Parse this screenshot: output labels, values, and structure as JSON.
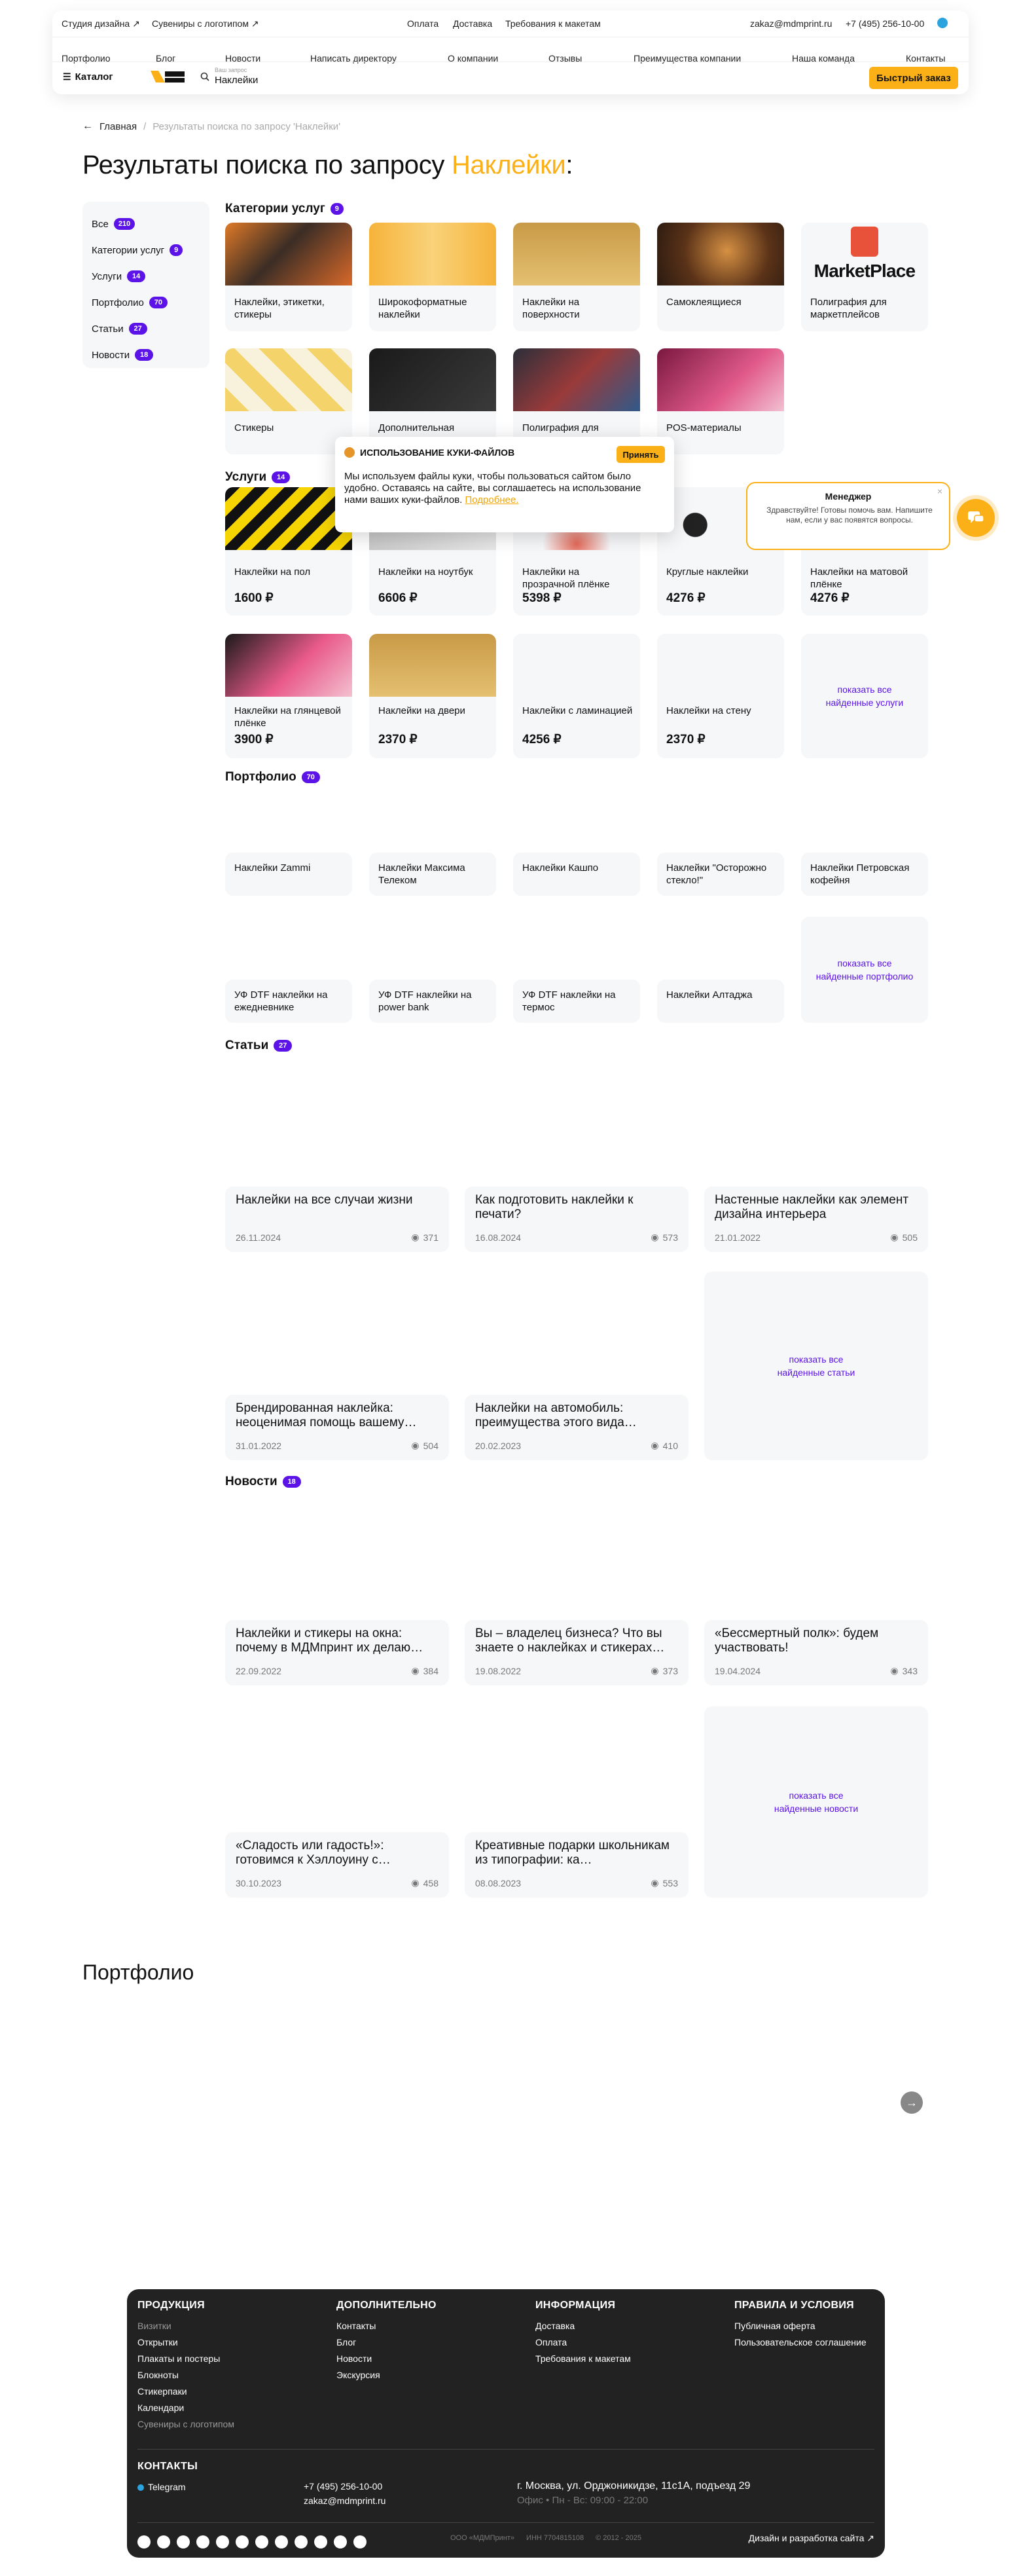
{
  "header": {
    "top_left": [
      "Студия дизайна ↗",
      "Сувениры с логотипом ↗"
    ],
    "top_mid": [
      "Оплата",
      "Доставка",
      "Требования к макетам"
    ],
    "email": "zakaz@mdmprint.ru",
    "phone": "+7 (495) 256-10-00",
    "nav": [
      "Портфолио",
      "Блог",
      "Новости",
      "Написать директору",
      "О компании",
      "Отзывы",
      "Преимущества компании",
      "Наша команда",
      "Контакты"
    ],
    "catalog_label": "Каталог",
    "search_label": "Ваш запрос",
    "search_value": "Наклейки",
    "quick_order": "Быстрый заказ"
  },
  "breadcrumb": {
    "home": "Главная",
    "sep": "/",
    "current": "Результаты поиска по запросу 'Наклейки'"
  },
  "title": {
    "prefix": "Результаты поиска по запросу ",
    "query": "Наклейки",
    "suffix": ":"
  },
  "sidebar": [
    {
      "label": "Все",
      "count": "210"
    },
    {
      "label": "Категории услуг",
      "count": "9"
    },
    {
      "label": "Услуги",
      "count": "14"
    },
    {
      "label": "Портфолио",
      "count": "70"
    },
    {
      "label": "Статьи",
      "count": "27"
    },
    {
      "label": "Новости",
      "count": "18"
    }
  ],
  "categories": {
    "title": "Категории услуг",
    "count": "9",
    "items": [
      "Наклейки, этикетки, стикеры",
      "Широкоформатные наклейки",
      "Наклейки на поверхности",
      "Самоклеящиеся",
      "Полиграфия для маркетплейсов",
      "Стикеры",
      "Дополнительная",
      "Полиграфия для",
      "POS-материалы"
    ],
    "marketplace_logo": "MarketPlace"
  },
  "services": {
    "title": "Услуги",
    "count": "14",
    "items": [
      {
        "name": "Наклейки на пол",
        "price": "1600 ₽"
      },
      {
        "name": "Наклейки на ноутбук",
        "price": "6606 ₽"
      },
      {
        "name": "Наклейки на прозрачной плёнке",
        "price": "5398 ₽"
      },
      {
        "name": "Круглые наклейки",
        "price": "4276 ₽"
      },
      {
        "name": "Наклейки на матовой плёнке",
        "price": "4276 ₽"
      },
      {
        "name": "Наклейки на глянцевой плёнке",
        "price": "3900 ₽"
      },
      {
        "name": "Наклейки на двери",
        "price": "2370 ₽"
      },
      {
        "name": "Наклейки с ламинацией",
        "price": "4256 ₽"
      },
      {
        "name": "Наклейки на стену",
        "price": "2370 ₽"
      }
    ],
    "more": "показать все\nнайденные услуги"
  },
  "portfolio": {
    "title": "Портфолио",
    "count": "70",
    "items": [
      "Наклейки Zammi",
      "Наклейки Максима Телеком",
      "Наклейки Кашпо",
      "Наклейки \"Осторожно стекло!\"",
      "Наклейки Петровская кофейня",
      "УФ DTF наклейки на ежедневнике",
      "УФ DTF наклейки на power bank",
      "УФ DTF наклейки на термос",
      "Наклейки Алтаджа"
    ],
    "more": "показать все\nнайденные портфолио"
  },
  "articles": {
    "title": "Статьи",
    "count": "27",
    "items": [
      {
        "title": "Наклейки на все случаи жизни",
        "date": "26.11.2024",
        "views": "371"
      },
      {
        "title": "Как подготовить наклейки к печати?",
        "date": "16.08.2024",
        "views": "573"
      },
      {
        "title": "Настенные наклейки как элемент дизайна интерьера",
        "date": "21.01.2022",
        "views": "505"
      },
      {
        "title": "Брендированная наклейка: неоценимая помощь вашему…",
        "date": "31.01.2022",
        "views": "504"
      },
      {
        "title": "Наклейки на автомобиль: преимущества этого вида…",
        "date": "20.02.2023",
        "views": "410"
      }
    ],
    "more": "показать все\nнайденные статьи"
  },
  "news": {
    "title": "Новости",
    "count": "18",
    "items": [
      {
        "title": "Наклейки и стикеры на окна: почему в МДМпринт их делаю…",
        "date": "22.09.2022",
        "views": "384"
      },
      {
        "title": "Вы – владелец бизнеса? Что вы знаете о наклейках и стикерах…",
        "date": "19.08.2022",
        "views": "373"
      },
      {
        "title": "«Бессмертный полк»: будем участвовать!",
        "date": "19.04.2024",
        "views": "343"
      },
      {
        "title": "«Сладость или гадость!»: готовимся к Хэллоуину с…",
        "date": "30.10.2023",
        "views": "458"
      },
      {
        "title": "Креативные подарки школьникам из типографии: ка…",
        "date": "08.08.2023",
        "views": "553"
      }
    ],
    "more": "показать все\nнайденные новости"
  },
  "cookie": {
    "title": "ИСПОЛЬЗОВАНИЕ КУКИ-ФАЙЛОВ",
    "accept": "Принять",
    "text": "Мы используем файлы куки, чтобы пользоваться сайтом было удобно. Оставаясь на сайте, вы соглашаетесь на использование нами ваших куки-файлов.",
    "link": "Подробнее."
  },
  "chat": {
    "name": "Менеджер",
    "msg": "Здравствуйте! Готовы помочь вам. Напишите нам, если у вас появятся вопросы."
  },
  "portfolio_big": {
    "title": "Портфолио"
  },
  "footer": {
    "production": {
      "title": "ПРОДУКЦИЯ",
      "items": [
        "Визитки",
        "Открытки",
        "Плакаты и постеры",
        "Блокноты",
        "Стикерпаки",
        "Календари",
        "Сувениры с логотипом"
      ]
    },
    "extra": {
      "title": "ДОПОЛНИТЕЛЬНО",
      "items": [
        "Контакты",
        "Блог",
        "Новости",
        "Экскурсия"
      ]
    },
    "info": {
      "title": "ИНФОРМАЦИЯ",
      "items": [
        "Доставка",
        "Оплата",
        "Требования к макетам"
      ]
    },
    "rules": {
      "title": "ПРАВИЛА И УСЛОВИЯ",
      "items": [
        "Публичная оферта",
        "Пользовательское соглашение"
      ]
    },
    "contacts_title": "КОНТАКТЫ",
    "telegram": "Telegram",
    "phone": "+7 (495) 256-10-00",
    "email": "zakaz@mdmprint.ru",
    "address": "г. Москва, ул. Орджоникидзе, 11с1А, подъезд 29",
    "hours": "Офис • Пн - Вс: 09:00 - 22:00",
    "company": "ООО «МДМПринт»",
    "inn": "ИНН 7704815108",
    "years": "© 2012 - 2025",
    "design": "Дизайн и разработка сайта ↗"
  }
}
